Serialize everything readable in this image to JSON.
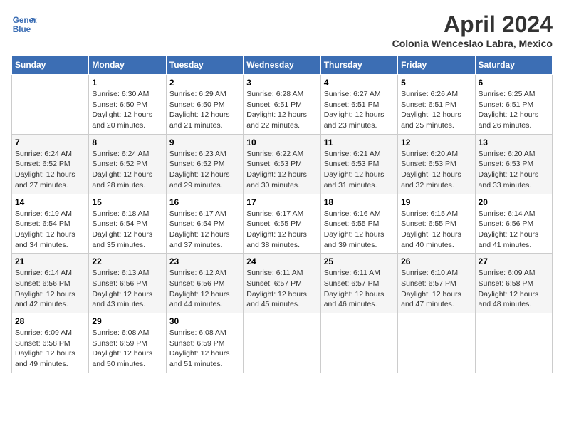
{
  "header": {
    "logo_line1": "General",
    "logo_line2": "Blue",
    "month_title": "April 2024",
    "subtitle": "Colonia Wenceslao Labra, Mexico"
  },
  "weekdays": [
    "Sunday",
    "Monday",
    "Tuesday",
    "Wednesday",
    "Thursday",
    "Friday",
    "Saturday"
  ],
  "weeks": [
    [
      {
        "day": "",
        "sunrise": "",
        "sunset": "",
        "daylight": ""
      },
      {
        "day": "1",
        "sunrise": "Sunrise: 6:30 AM",
        "sunset": "Sunset: 6:50 PM",
        "daylight": "Daylight: 12 hours and 20 minutes."
      },
      {
        "day": "2",
        "sunrise": "Sunrise: 6:29 AM",
        "sunset": "Sunset: 6:50 PM",
        "daylight": "Daylight: 12 hours and 21 minutes."
      },
      {
        "day": "3",
        "sunrise": "Sunrise: 6:28 AM",
        "sunset": "Sunset: 6:51 PM",
        "daylight": "Daylight: 12 hours and 22 minutes."
      },
      {
        "day": "4",
        "sunrise": "Sunrise: 6:27 AM",
        "sunset": "Sunset: 6:51 PM",
        "daylight": "Daylight: 12 hours and 23 minutes."
      },
      {
        "day": "5",
        "sunrise": "Sunrise: 6:26 AM",
        "sunset": "Sunset: 6:51 PM",
        "daylight": "Daylight: 12 hours and 25 minutes."
      },
      {
        "day": "6",
        "sunrise": "Sunrise: 6:25 AM",
        "sunset": "Sunset: 6:51 PM",
        "daylight": "Daylight: 12 hours and 26 minutes."
      }
    ],
    [
      {
        "day": "7",
        "sunrise": "Sunrise: 6:24 AM",
        "sunset": "Sunset: 6:52 PM",
        "daylight": "Daylight: 12 hours and 27 minutes."
      },
      {
        "day": "8",
        "sunrise": "Sunrise: 6:24 AM",
        "sunset": "Sunset: 6:52 PM",
        "daylight": "Daylight: 12 hours and 28 minutes."
      },
      {
        "day": "9",
        "sunrise": "Sunrise: 6:23 AM",
        "sunset": "Sunset: 6:52 PM",
        "daylight": "Daylight: 12 hours and 29 minutes."
      },
      {
        "day": "10",
        "sunrise": "Sunrise: 6:22 AM",
        "sunset": "Sunset: 6:53 PM",
        "daylight": "Daylight: 12 hours and 30 minutes."
      },
      {
        "day": "11",
        "sunrise": "Sunrise: 6:21 AM",
        "sunset": "Sunset: 6:53 PM",
        "daylight": "Daylight: 12 hours and 31 minutes."
      },
      {
        "day": "12",
        "sunrise": "Sunrise: 6:20 AM",
        "sunset": "Sunset: 6:53 PM",
        "daylight": "Daylight: 12 hours and 32 minutes."
      },
      {
        "day": "13",
        "sunrise": "Sunrise: 6:20 AM",
        "sunset": "Sunset: 6:53 PM",
        "daylight": "Daylight: 12 hours and 33 minutes."
      }
    ],
    [
      {
        "day": "14",
        "sunrise": "Sunrise: 6:19 AM",
        "sunset": "Sunset: 6:54 PM",
        "daylight": "Daylight: 12 hours and 34 minutes."
      },
      {
        "day": "15",
        "sunrise": "Sunrise: 6:18 AM",
        "sunset": "Sunset: 6:54 PM",
        "daylight": "Daylight: 12 hours and 35 minutes."
      },
      {
        "day": "16",
        "sunrise": "Sunrise: 6:17 AM",
        "sunset": "Sunset: 6:54 PM",
        "daylight": "Daylight: 12 hours and 37 minutes."
      },
      {
        "day": "17",
        "sunrise": "Sunrise: 6:17 AM",
        "sunset": "Sunset: 6:55 PM",
        "daylight": "Daylight: 12 hours and 38 minutes."
      },
      {
        "day": "18",
        "sunrise": "Sunrise: 6:16 AM",
        "sunset": "Sunset: 6:55 PM",
        "daylight": "Daylight: 12 hours and 39 minutes."
      },
      {
        "day": "19",
        "sunrise": "Sunrise: 6:15 AM",
        "sunset": "Sunset: 6:55 PM",
        "daylight": "Daylight: 12 hours and 40 minutes."
      },
      {
        "day": "20",
        "sunrise": "Sunrise: 6:14 AM",
        "sunset": "Sunset: 6:56 PM",
        "daylight": "Daylight: 12 hours and 41 minutes."
      }
    ],
    [
      {
        "day": "21",
        "sunrise": "Sunrise: 6:14 AM",
        "sunset": "Sunset: 6:56 PM",
        "daylight": "Daylight: 12 hours and 42 minutes."
      },
      {
        "day": "22",
        "sunrise": "Sunrise: 6:13 AM",
        "sunset": "Sunset: 6:56 PM",
        "daylight": "Daylight: 12 hours and 43 minutes."
      },
      {
        "day": "23",
        "sunrise": "Sunrise: 6:12 AM",
        "sunset": "Sunset: 6:56 PM",
        "daylight": "Daylight: 12 hours and 44 minutes."
      },
      {
        "day": "24",
        "sunrise": "Sunrise: 6:11 AM",
        "sunset": "Sunset: 6:57 PM",
        "daylight": "Daylight: 12 hours and 45 minutes."
      },
      {
        "day": "25",
        "sunrise": "Sunrise: 6:11 AM",
        "sunset": "Sunset: 6:57 PM",
        "daylight": "Daylight: 12 hours and 46 minutes."
      },
      {
        "day": "26",
        "sunrise": "Sunrise: 6:10 AM",
        "sunset": "Sunset: 6:57 PM",
        "daylight": "Daylight: 12 hours and 47 minutes."
      },
      {
        "day": "27",
        "sunrise": "Sunrise: 6:09 AM",
        "sunset": "Sunset: 6:58 PM",
        "daylight": "Daylight: 12 hours and 48 minutes."
      }
    ],
    [
      {
        "day": "28",
        "sunrise": "Sunrise: 6:09 AM",
        "sunset": "Sunset: 6:58 PM",
        "daylight": "Daylight: 12 hours and 49 minutes."
      },
      {
        "day": "29",
        "sunrise": "Sunrise: 6:08 AM",
        "sunset": "Sunset: 6:59 PM",
        "daylight": "Daylight: 12 hours and 50 minutes."
      },
      {
        "day": "30",
        "sunrise": "Sunrise: 6:08 AM",
        "sunset": "Sunset: 6:59 PM",
        "daylight": "Daylight: 12 hours and 51 minutes."
      },
      {
        "day": "",
        "sunrise": "",
        "sunset": "",
        "daylight": ""
      },
      {
        "day": "",
        "sunrise": "",
        "sunset": "",
        "daylight": ""
      },
      {
        "day": "",
        "sunrise": "",
        "sunset": "",
        "daylight": ""
      },
      {
        "day": "",
        "sunrise": "",
        "sunset": "",
        "daylight": ""
      }
    ]
  ]
}
